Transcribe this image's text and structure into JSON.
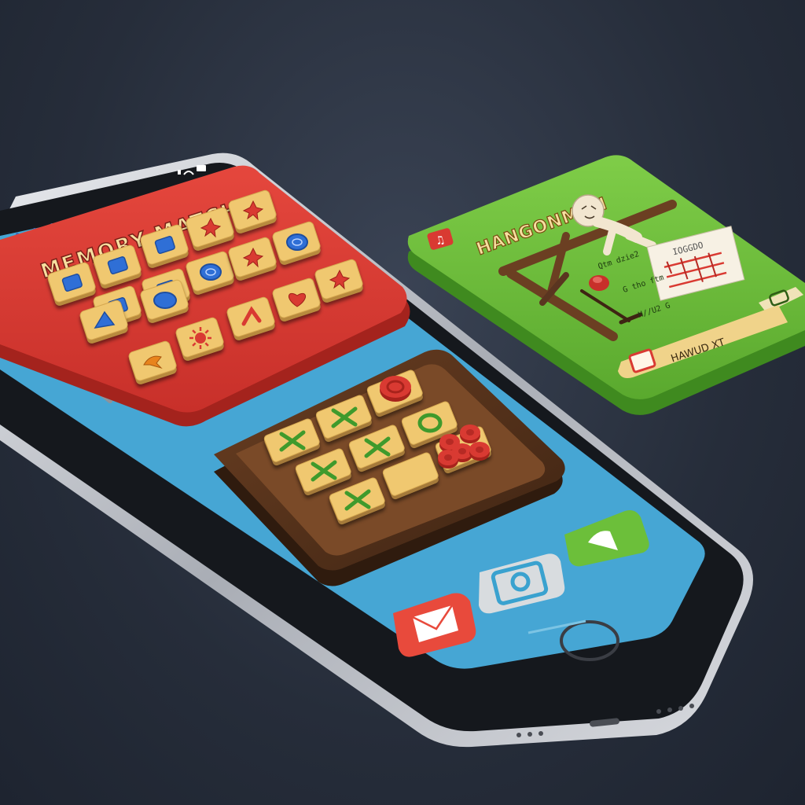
{
  "colors": {
    "background": "#2a3140",
    "memory_board": "#d93a32",
    "hangman_board": "#6cbf3a",
    "tictactoe_frame": "#5a3520",
    "tile": "#f0c870",
    "screen": "#46a6d4",
    "phone_frame": "#c9ccd2"
  },
  "phone": {
    "status_bar": {
      "signal": "signal-icon",
      "wifi": "wifi-icon",
      "battery": "battery-icon"
    }
  },
  "memory_match": {
    "title": "MEMORY MATCH",
    "tiles": [
      "square",
      "square",
      "square",
      "splat",
      "square",
      "square",
      "splat",
      "circle",
      "square",
      "circle",
      "splat",
      "splat",
      "triangle",
      "blob",
      "arrow",
      "heart",
      "bird",
      "sun"
    ]
  },
  "tic_tac_toe": {
    "cells": [
      "X",
      "X",
      "O-red",
      "X",
      "X",
      "O",
      "X",
      "empty",
      "O-red-stack",
      "O",
      "empty",
      "empty"
    ]
  },
  "hangman": {
    "title": "HANGONMAN",
    "music_icon": "music-note-icon",
    "guess_lines": [
      "Qtm dzie2",
      "G tho ftm",
      "H//U2 G"
    ],
    "note_header": "IOGGDO",
    "answer_label": "HAWUD XT",
    "chat_icon": "chat-bubble-icon"
  },
  "dock": {
    "mail": "mail-icon",
    "camera": "camera-icon",
    "messages": "message-icon"
  }
}
